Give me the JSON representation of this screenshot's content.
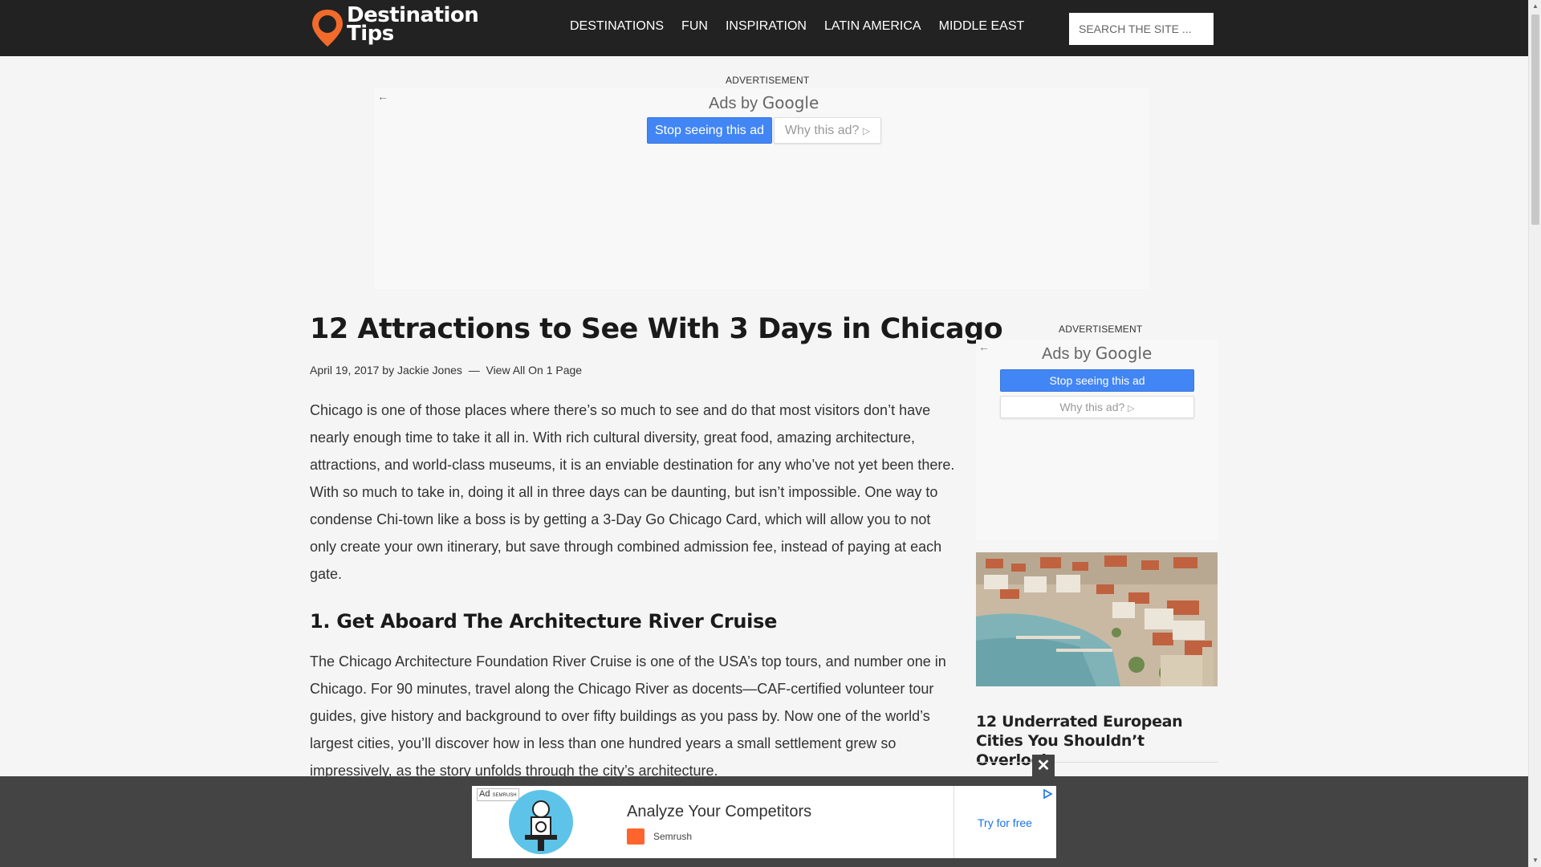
{
  "header": {
    "logo_line1": "Destination",
    "logo_line2": "Tips",
    "nav": [
      "DESTINATIONS",
      "FUN",
      "INSPIRATION",
      "LATIN AMERICA",
      "MIDDLE EAST"
    ],
    "search_placeholder": "SEARCH THE SITE ..."
  },
  "top_ad": {
    "label": "ADVERTISEMENT",
    "ads_by_prefix": "Ads by",
    "ads_by_brand": "Google",
    "stop_label": "Stop seeing this ad",
    "why_label": "Why this ad?"
  },
  "article": {
    "title": "12 Attractions to See With 3 Days in Chicago",
    "date": "April 19, 2017",
    "by": "by",
    "author": "Jackie Jones",
    "sep": "—",
    "view_all": "View All On 1 Page",
    "intro": "Chicago is one of those places where there’s so much to see and do that most visitors don’t have nearly enough time to take it all in. With rich cultural diversity, great food, amazing architecture, attractions, and world-class museums, it is an enviable destination for any who’ve not yet been there. With so much to take in, doing it all in three days can be daunting, but isn’t impossible. One way to condense Chi-town like a boss is by getting a 3-Day Go Chicago Card, which will allow you to not only create your own itinerary, but save through combined admission fee, instead of paying at each gate.",
    "section1_heading": "1. Get Aboard The Architecture River Cruise",
    "section1_text": "The Chicago Architecture Foundation River Cruise is one of the USA’s top tours, and number one in Chicago. For 90 minutes, travel along the Chicago River as docents—CAF-certified volunteer tour guides, give history and background to over fifty buildings as you pass by. Now one of the world’s largest cities, you’ll discover how in less than one hundred years a small settlement grew so impressively, as the story unfolds through the city’s architecture."
  },
  "side_ad": {
    "label": "ADVERTISEMENT",
    "ads_by_prefix": "Ads by",
    "ads_by_brand": "Google",
    "stop_label": "Stop seeing this ad",
    "why_label": "Why this ad?"
  },
  "sidebar": {
    "related_title": "12 Underrated European Cities You Shouldn’t Overlook"
  },
  "bottom_ad": {
    "ad_tag": "Ad",
    "ad_tag_small": "SEMRUSH",
    "close": "✕",
    "headline": "Analyze Your Competitors",
    "brand": "Semrush",
    "cta": "Try for free"
  },
  "colors": {
    "header_bg": "#222222",
    "logo_orange": "#f26b2b",
    "google_blue": "#4285f4",
    "semrush_orange": "#ff642d"
  }
}
